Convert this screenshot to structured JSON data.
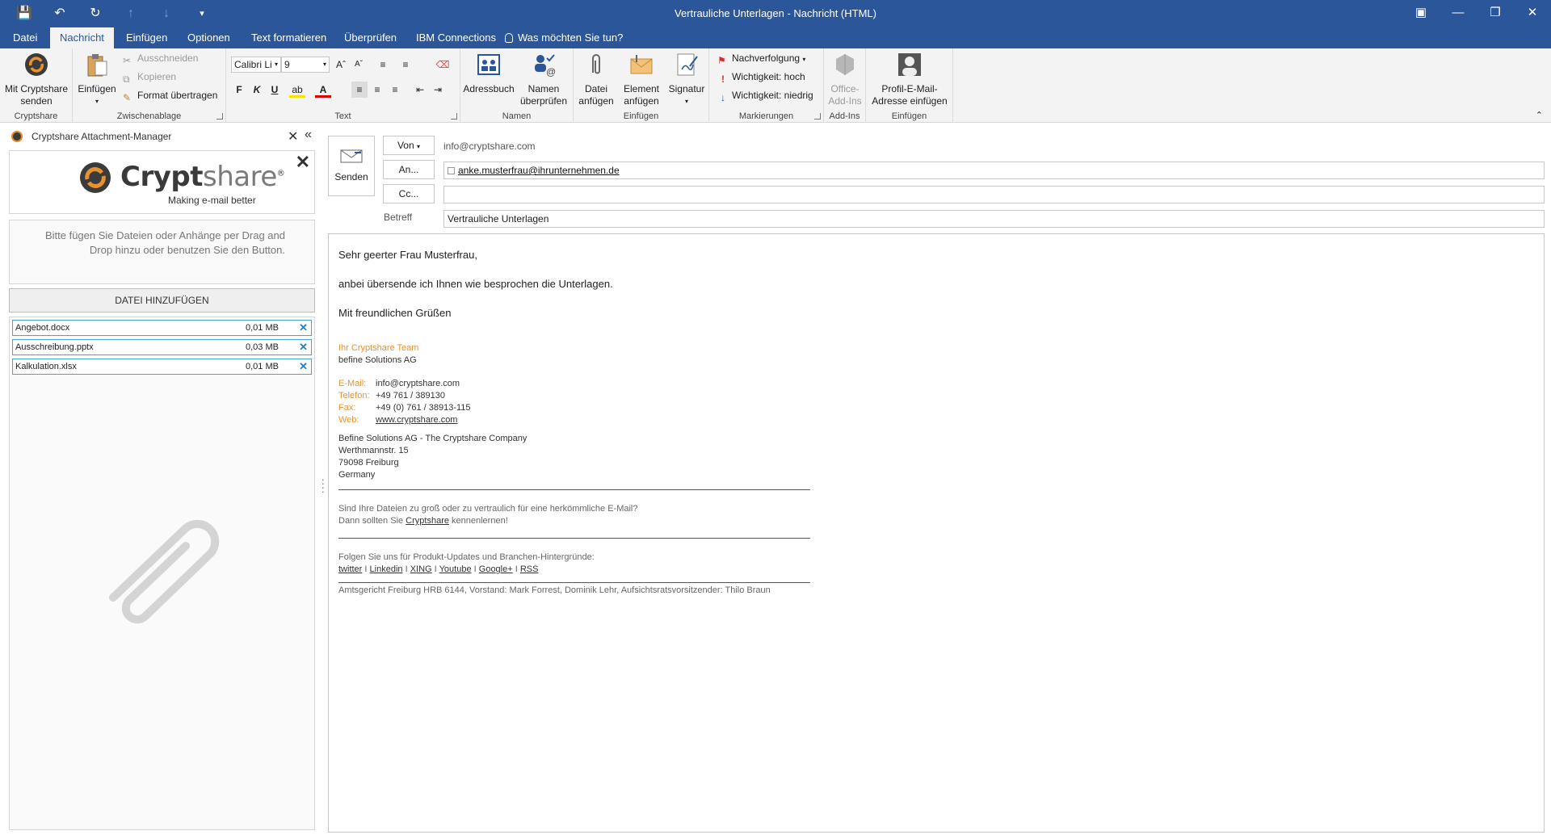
{
  "window": {
    "title": "Vertrauliche Unterlagen - Nachricht (HTML)",
    "qat": [
      "save-icon",
      "undo-icon",
      "redo-icon",
      "up-arrow-icon",
      "down-arrow-icon",
      "customize-icon"
    ],
    "controls": [
      "ribbon-display-icon",
      "minimize-icon",
      "restore-icon",
      "close-icon"
    ]
  },
  "tabs": [
    "Datei",
    "Nachricht",
    "Einfügen",
    "Optionen",
    "Text formatieren",
    "Überprüfen",
    "IBM Connections"
  ],
  "tellme": "Was möchten Sie tun?",
  "ribbon": {
    "cryptshare": {
      "button_line1": "Mit Cryptshare",
      "button_line2": "senden",
      "label": "Cryptshare"
    },
    "clipboard": {
      "paste": "Einfügen",
      "cut": "Ausschneiden",
      "copy": "Kopieren",
      "format_painter": "Format übertragen",
      "label": "Zwischenablage"
    },
    "text": {
      "font": "Calibri Li",
      "size": "9",
      "bold": "F",
      "italic": "K",
      "underline": "U",
      "label": "Text"
    },
    "names": {
      "address_book": "Adressbuch",
      "check_line1": "Namen",
      "check_line2": "überprüfen",
      "label": "Namen"
    },
    "insert": {
      "file_line1": "Datei",
      "file_line2": "anfügen",
      "item_line1": "Element",
      "item_line2": "anfügen",
      "signature": "Signatur",
      "label": "Einfügen"
    },
    "tags": {
      "follow_up": "Nachverfolgung",
      "high": "Wichtigkeit: hoch",
      "low": "Wichtigkeit: niedrig",
      "label": "Markierungen"
    },
    "addins": {
      "line1": "Office-",
      "line2": "Add-Ins",
      "label": "Add-Ins"
    },
    "profile": {
      "line1": "Profil-E-Mail-",
      "line2": "Adresse einfügen",
      "label": "Einfügen"
    }
  },
  "pane": {
    "title": "Cryptshare Attachment-Manager",
    "logo_bold": "Crypt",
    "logo_light": "share",
    "logo_reg": "®",
    "tagline": "Making e-mail better",
    "drop_hint": "Bitte fügen Sie Dateien oder Anhänge per Drag and Drop hinzu oder benutzen Sie den Button.",
    "add_button": "DATEI HINZUFÜGEN",
    "files": [
      {
        "name": "Angebot.docx",
        "size": "0,01 MB"
      },
      {
        "name": "Ausschreibung.pptx",
        "size": "0,03 MB"
      },
      {
        "name": "Kalkulation.xlsx",
        "size": "0,01 MB"
      }
    ]
  },
  "compose": {
    "send": "Senden",
    "from_btn": "Von",
    "from_value": "info@cryptshare.com",
    "to_btn": "An...",
    "to_value": "anke.musterfrau@ihrunternehmen.de",
    "cc_btn": "Cc...",
    "cc_value": "",
    "subject_label": "Betreff",
    "subject_value": "Vertrauliche Unterlagen"
  },
  "body": {
    "greeting": "Sehr geerter Frau Musterfrau,",
    "line1": "anbei übersende ich Ihnen wie besprochen die Unterlagen.",
    "closing": "Mit freundlichen Grüßen",
    "sig_team": "Ihr Cryptshare Team",
    "sig_company": "befine Solutions AG",
    "email_label": "E-Mail:",
    "email_value": "info@cryptshare.com",
    "phone_label": "Telefon:",
    "phone_value": "+49 761 / 389130",
    "fax_label": "Fax:",
    "fax_value": "+49 (0) 761 / 38913-115",
    "web_label": "Web:",
    "web_value": "www.cryptshare.com",
    "addr1": "Befine Solutions AG - The Cryptshare Company",
    "addr2": "Werthmannstr. 15",
    "addr3": "79098 Freiburg",
    "addr4": "Germany",
    "promo1": "Sind Ihre Dateien zu groß oder zu vertraulich für eine herkömmliche E-Mail?",
    "promo2_pre": "Dann sollten Sie ",
    "promo2_link": "Cryptshare",
    "promo2_post": " kennenlernen!",
    "follow": "Folgen Sie uns für Produkt-Updates und Branchen-Hintergründe:",
    "social": [
      "twitter",
      "Linkedin",
      "XING",
      "Youtube",
      "Google+",
      "RSS"
    ],
    "sep": "I",
    "legal": "Amtsgericht Freiburg HRB 6144, Vorstand: Mark Forrest, Dominik Lehr, Aufsichtsratsvorsitzender: Thilo Braun"
  },
  "colors": {
    "accent": "#2b579a",
    "orange": "#e8922e",
    "file_border": "#47a7c7"
  }
}
